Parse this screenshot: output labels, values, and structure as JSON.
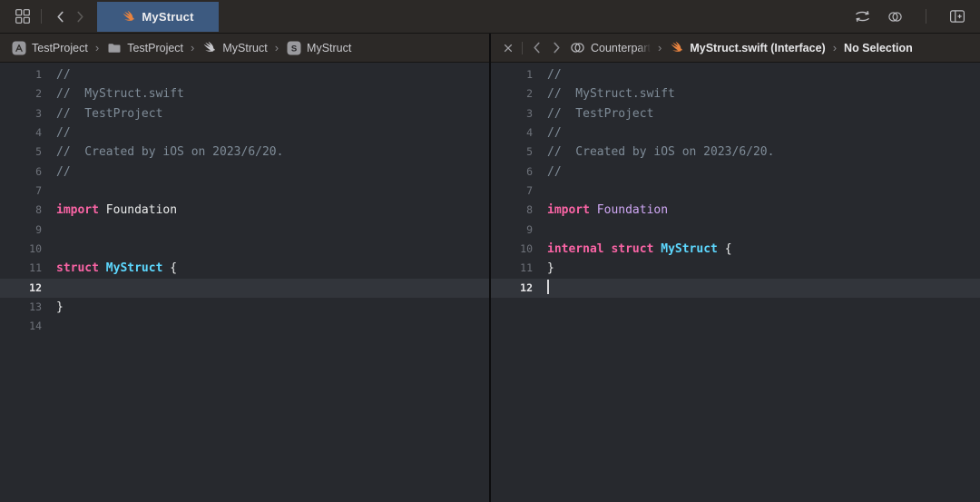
{
  "colors": {
    "tab_selected": "#3d5a80",
    "swift_orange": "#e8833f",
    "gray_icon": "#c9c9cd",
    "keyword_pink": "#fa64a5",
    "type_cyan": "#5dd8ff",
    "module_lavender": "#d0a8f5",
    "comment_gray": "#7f8c98",
    "editor_bg": "#27292e",
    "current_line_bg": "#32353b"
  },
  "toolbar": {
    "left_icons": [
      {
        "icon": "related-items",
        "name": "related-items-icon",
        "dim": false
      },
      {
        "icon": "divider"
      },
      {
        "icon": "chevron-left",
        "name": "back-chevron-icon",
        "dim": false
      },
      {
        "icon": "chevron-right",
        "name": "forward-chevron-icon",
        "dim": true
      }
    ],
    "tab": {
      "label": "MyStruct",
      "icon": "swift-icon"
    },
    "right_icons": [
      {
        "icon": "swap-arrows",
        "name": "code-review-icon",
        "dim": false
      },
      {
        "icon": "counterparts",
        "name": "counterparts-icon",
        "dim": false
      },
      {
        "icon": "divider"
      },
      {
        "icon": "add-editor",
        "name": "add-editor-icon",
        "dim": false
      }
    ]
  },
  "left_pane": {
    "jump_bar": {
      "controls": [],
      "items": [
        {
          "icon": "app",
          "icon_name": "app-icon",
          "label": "TestProject"
        },
        {
          "icon": "folder",
          "icon_name": "folder-icon",
          "label": "TestProject"
        },
        {
          "icon": "swift",
          "icon_name": "swift-icon",
          "icon_color": "#c9c9cd",
          "label": "MyStruct"
        },
        {
          "icon": "struct",
          "icon_name": "struct-icon",
          "label": "MyStruct"
        }
      ]
    },
    "code": {
      "current_line": 12,
      "cursor_line": null,
      "lines": [
        {
          "n": 1,
          "tokens": [
            [
              "//",
              "c"
            ]
          ]
        },
        {
          "n": 2,
          "tokens": [
            [
              "//  MyStruct.swift",
              "c"
            ]
          ]
        },
        {
          "n": 3,
          "tokens": [
            [
              "//  TestProject",
              "c"
            ]
          ]
        },
        {
          "n": 4,
          "tokens": [
            [
              "//",
              "c"
            ]
          ]
        },
        {
          "n": 5,
          "tokens": [
            [
              "//  Created by iOS on 2023/6/20.",
              "c"
            ]
          ]
        },
        {
          "n": 6,
          "tokens": [
            [
              "//",
              "c"
            ]
          ]
        },
        {
          "n": 7,
          "tokens": []
        },
        {
          "n": 8,
          "tokens": [
            [
              "import",
              "k"
            ],
            [
              " Foundation",
              "p"
            ]
          ]
        },
        {
          "n": 9,
          "tokens": []
        },
        {
          "n": 10,
          "tokens": []
        },
        {
          "n": 11,
          "tokens": [
            [
              "struct",
              "k"
            ],
            [
              " ",
              "p"
            ],
            [
              "MyStruct",
              "t"
            ],
            [
              " {",
              "p"
            ]
          ]
        },
        {
          "n": 12,
          "tokens": []
        },
        {
          "n": 13,
          "tokens": [
            [
              "}",
              "p"
            ]
          ]
        },
        {
          "n": 14,
          "tokens": []
        }
      ]
    }
  },
  "right_pane": {
    "jump_bar": {
      "controls": [
        {
          "icon": "close",
          "name": "close-editor-icon",
          "dim": false
        },
        {
          "icon": "divider"
        },
        {
          "icon": "chevron-left",
          "name": "back-chevron-icon",
          "dim": true
        },
        {
          "icon": "chevron-right",
          "name": "forward-chevron-icon",
          "dim": true
        }
      ],
      "items": [
        {
          "icon": "counterparts",
          "icon_name": "counterparts-icon",
          "icon_color": "#c0c0c4",
          "label": "Counterpart",
          "fade": true
        },
        {
          "icon": "swift",
          "icon_name": "swift-icon",
          "icon_color": "#e8833f",
          "label": "MyStruct.swift (Interface)",
          "bold": true
        },
        {
          "icon": null,
          "label": "No Selection",
          "bold": true
        }
      ]
    },
    "code": {
      "current_line": 12,
      "cursor_line": 12,
      "lines": [
        {
          "n": 1,
          "tokens": [
            [
              "//",
              "c"
            ]
          ]
        },
        {
          "n": 2,
          "tokens": [
            [
              "//  MyStruct.swift",
              "c"
            ]
          ]
        },
        {
          "n": 3,
          "tokens": [
            [
              "//  TestProject",
              "c"
            ]
          ]
        },
        {
          "n": 4,
          "tokens": [
            [
              "//",
              "c"
            ]
          ]
        },
        {
          "n": 5,
          "tokens": [
            [
              "//  Created by iOS on 2023/6/20.",
              "c"
            ]
          ]
        },
        {
          "n": 6,
          "tokens": [
            [
              "//",
              "c"
            ]
          ]
        },
        {
          "n": 7,
          "tokens": []
        },
        {
          "n": 8,
          "tokens": [
            [
              "import",
              "k"
            ],
            [
              " ",
              "p"
            ],
            [
              "Foundation",
              "m"
            ]
          ]
        },
        {
          "n": 9,
          "tokens": []
        },
        {
          "n": 10,
          "tokens": [
            [
              "internal",
              "k"
            ],
            [
              " ",
              "p"
            ],
            [
              "struct",
              "k"
            ],
            [
              " ",
              "p"
            ],
            [
              "MyStruct",
              "t"
            ],
            [
              " {",
              "p"
            ]
          ]
        },
        {
          "n": 11,
          "tokens": [
            [
              "}",
              "p"
            ]
          ]
        },
        {
          "n": 12,
          "tokens": []
        }
      ]
    }
  }
}
